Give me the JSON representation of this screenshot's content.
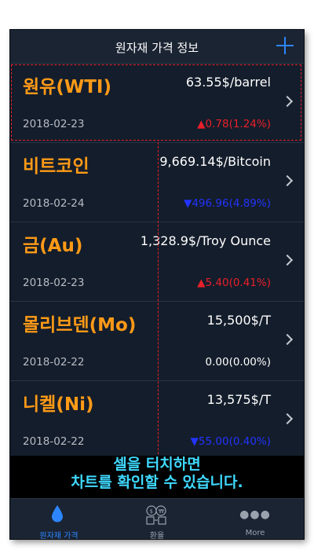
{
  "navbar": {
    "title": "원자재 가격 정보"
  },
  "items": [
    {
      "name": "원유(WTI)",
      "price": "63.55$/barrel",
      "date": "2018-02-23",
      "change": "▲0.78(1.24%)",
      "direction": "up"
    },
    {
      "name": "비트코인",
      "price": "9,669.14$/Bitcoin",
      "date": "2018-02-24",
      "change": "▼496.96(4.89%)",
      "direction": "down"
    },
    {
      "name": "금(Au)",
      "price": "1,328.9$/Troy Ounce",
      "date": "2018-02-23",
      "change": "▲5.40(0.41%)",
      "direction": "up"
    },
    {
      "name": "몰리브덴(Mo)",
      "price": "15,500$/T",
      "date": "2018-02-22",
      "change": "0.00(0.00%)",
      "direction": "flat"
    },
    {
      "name": "니켈(Ni)",
      "price": "13,575$/T",
      "date": "2018-02-22",
      "change": "▼55.00(0.40%)",
      "direction": "down"
    }
  ],
  "overlay": {
    "line1": "셀을 터치하면",
    "line2": "차트를 확인할 수 있습니다."
  },
  "tabs": [
    {
      "label": "원자재 가격",
      "icon": "drop-icon",
      "active": true
    },
    {
      "label": "환율",
      "icon": "exchange-icon",
      "active": false
    },
    {
      "label": "More",
      "icon": "more-dots-icon",
      "active": false
    }
  ],
  "colors": {
    "accent": "#2d86ff",
    "name_orange": "#ff9a17",
    "up_red": "#e8202a",
    "down_blue": "#2234ff",
    "overlay_text": "#3fd9ff",
    "background": "#141d2b"
  }
}
